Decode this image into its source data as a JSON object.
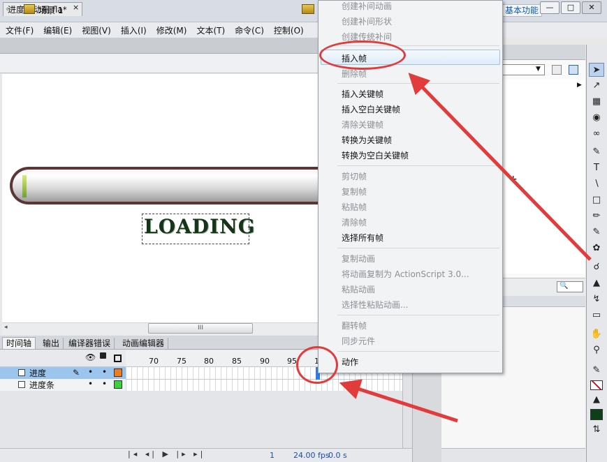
{
  "app": {
    "logo": "Fl",
    "workspace_label": "基本功能",
    "window_buttons": [
      "—",
      "□",
      "✕"
    ]
  },
  "menu": [
    "文件(F)",
    "编辑(E)",
    "视图(V)",
    "插入(I)",
    "修改(M)",
    "文本(T)",
    "命令(C)",
    "控制(O)"
  ],
  "document": {
    "tab_title": "进度条动画.fla*",
    "tab_close": "×",
    "scene": "场景 1"
  },
  "stage": {
    "loading_text": "LOADING",
    "progress": 0.03
  },
  "scroll": {
    "thumb_grip": "III",
    "left_arrow": "◂"
  },
  "timeline": {
    "tabs": [
      "时间轴",
      "输出",
      "编译器错误",
      "动画编辑器"
    ],
    "ruler_ticks": [
      "70",
      "75",
      "80",
      "85",
      "90",
      "95",
      "1"
    ],
    "layers": [
      {
        "name": "进度",
        "color": "#f07c22",
        "selected": true
      },
      {
        "name": "进度条",
        "color": "#3dd13d",
        "selected": false
      }
    ],
    "current_frame": "1",
    "fps": "24.00 fps",
    "time": "0.0 s",
    "controls": "|◂ ◂| ▶ |▸ ▸|"
  },
  "context_menu": {
    "items": [
      {
        "label": "创建补间动画",
        "enabled": false
      },
      {
        "label": "创建补间形状",
        "enabled": false
      },
      {
        "label": "创建传统补间",
        "enabled": false
      },
      {
        "label": "插入帧",
        "enabled": true,
        "highlighted": true
      },
      {
        "label": "删除帧",
        "enabled": false
      },
      {
        "label": "插入关键帧",
        "enabled": true
      },
      {
        "label": "插入空白关键帧",
        "enabled": true
      },
      {
        "label": "清除关键帧",
        "enabled": false
      },
      {
        "label": "转换为关键帧",
        "enabled": true
      },
      {
        "label": "转换为空白关键帧",
        "enabled": true
      },
      {
        "label": "剪切帧",
        "enabled": false
      },
      {
        "label": "复制帧",
        "enabled": false
      },
      {
        "label": "粘贴帧",
        "enabled": false
      },
      {
        "label": "清除帧",
        "enabled": false
      },
      {
        "label": "选择所有帧",
        "enabled": true
      },
      {
        "label": "复制动画",
        "enabled": false
      },
      {
        "label": "将动画复制为 ActionScript 3.0...",
        "enabled": false
      },
      {
        "label": "粘贴动画",
        "enabled": false
      },
      {
        "label": "选择性粘贴动画...",
        "enabled": false
      },
      {
        "label": "翻转帧",
        "enabled": false
      },
      {
        "label": "同步元件",
        "enabled": false
      },
      {
        "label": "动作",
        "enabled": true
      }
    ]
  },
  "annotations": {
    "color": "#e23b3b"
  },
  "colors": {
    "accent": "#2e7fe0",
    "selection": "#9cc5ee"
  }
}
